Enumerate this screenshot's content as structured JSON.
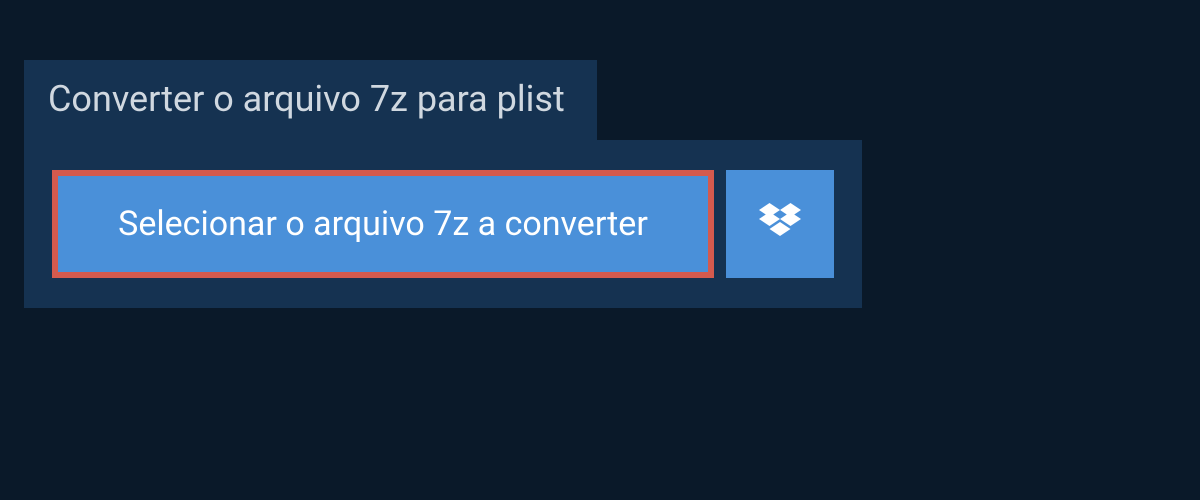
{
  "title": "Converter o arquivo 7z para plist",
  "selectButton": {
    "label": "Selecionar o arquivo 7z a converter"
  },
  "dropboxButton": {
    "iconName": "dropbox-icon"
  }
}
